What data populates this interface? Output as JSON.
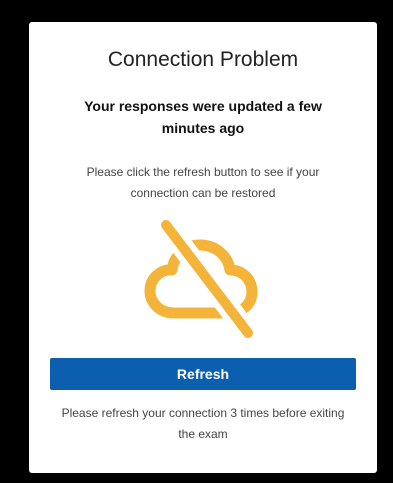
{
  "dialog": {
    "title": "Connection Problem",
    "subtitle": "Your responses were updated a few minutes ago",
    "message": "Please click the refresh button to see if your connection can be restored",
    "icon": "cloud-offline-icon",
    "icon_color": "#f4b43a",
    "refresh_label": "Refresh",
    "refresh_color": "#0b5fae",
    "footer_note": "Please refresh your connection 3 times before exiting the exam"
  }
}
